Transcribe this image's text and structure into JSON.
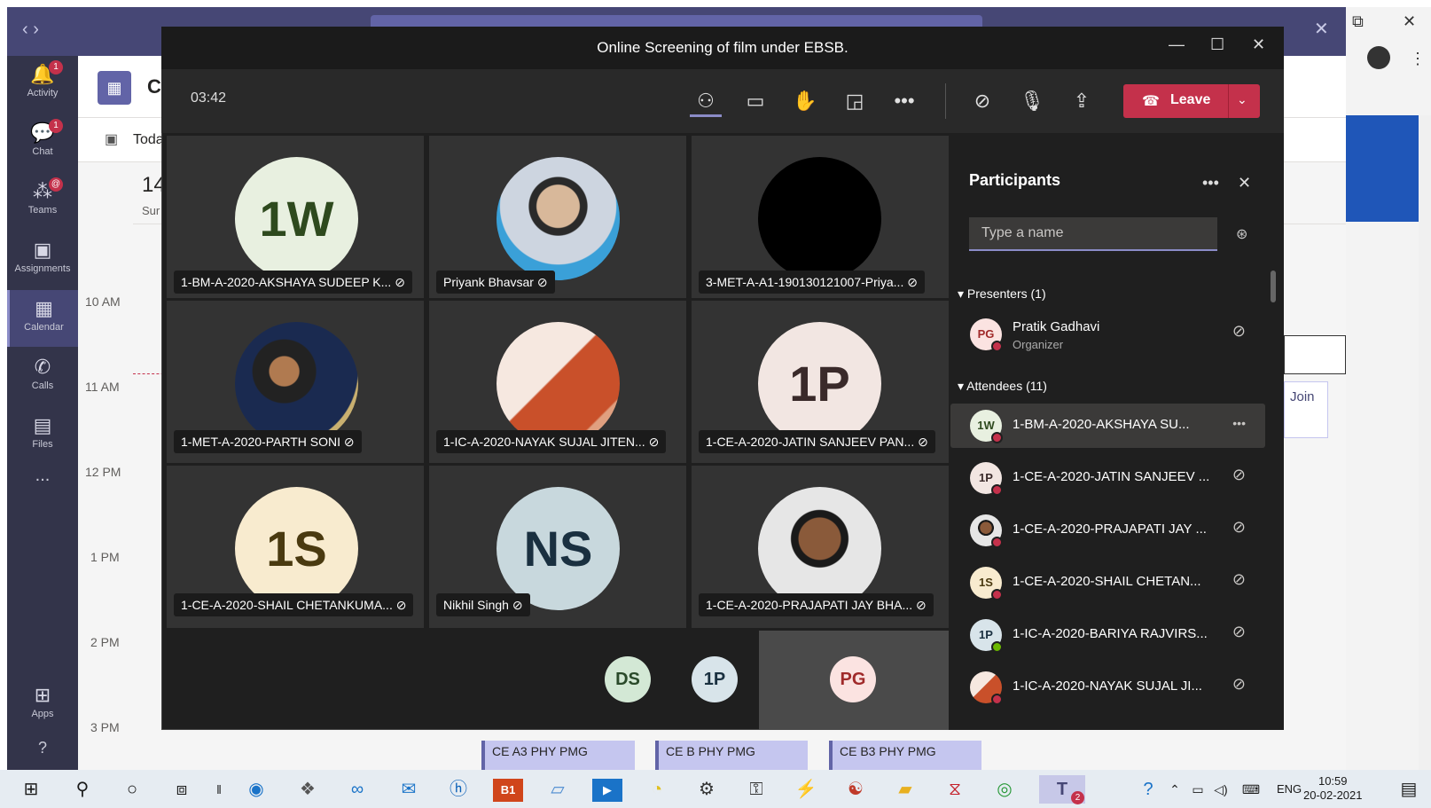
{
  "teams_rail": {
    "items": [
      {
        "label": "Activity",
        "icon": "bell-icon",
        "badge": "1"
      },
      {
        "label": "Chat",
        "icon": "chat-icon",
        "badge": "1"
      },
      {
        "label": "Teams",
        "icon": "teams-icon",
        "badge": "@"
      },
      {
        "label": "Assignments",
        "icon": "assignments-icon",
        "badge": ""
      },
      {
        "label": "Calendar",
        "icon": "calendar-icon",
        "badge": ""
      },
      {
        "label": "Calls",
        "icon": "phone-icon",
        "badge": ""
      },
      {
        "label": "Files",
        "icon": "file-icon",
        "badge": ""
      },
      {
        "label": "...",
        "icon": "more-icon",
        "badge": ""
      }
    ],
    "apps_label": "Apps",
    "help": "?"
  },
  "calendar": {
    "title": "Ca",
    "today_label": "Toda",
    "day_number": "14",
    "day_name": "Sur",
    "times": [
      "10 AM",
      "11 AM",
      "12 PM",
      "1 PM",
      "2 PM",
      "3 PM"
    ],
    "events": [
      "CE A3 PHY PMG",
      "CE B PHY PMG",
      "CE B3 PHY PMG"
    ],
    "join_label": "Join"
  },
  "meeting": {
    "title": "Online Screening of film under EBSB.",
    "timer": "03:42",
    "leave_label": "Leave",
    "tiles": [
      {
        "initials": "1W",
        "name": "1-BM-A-2020-AKSHAYA SUDEEP K..."
      },
      {
        "initials": "",
        "name": "Priyank Bhavsar"
      },
      {
        "initials": "",
        "name": "3-MET-A-A1-190130121007-Priya..."
      },
      {
        "initials": "",
        "name": "1-MET-A-2020-PARTH SONI"
      },
      {
        "initials": "",
        "name": "1-IC-A-2020-NAYAK SUJAL JITEN..."
      },
      {
        "initials": "1P",
        "name": "1-CE-A-2020-JATIN SANJEEV PAN..."
      },
      {
        "initials": "1S",
        "name": "1-CE-A-2020-SHAIL CHETANKUMA..."
      },
      {
        "initials": "NS",
        "name": "Nikhil Singh"
      },
      {
        "initials": "",
        "name": "1-CE-A-2020-PRAJAPATI JAY BHA..."
      }
    ],
    "overflow": [
      "DS",
      "1P",
      "PG"
    ]
  },
  "participants": {
    "title": "Participants",
    "search_placeholder": "Type a name",
    "presenters_label": "Presenters (1)",
    "attendees_label": "Attendees (11)",
    "presenter": {
      "initials": "PG",
      "name": "Pratik Gadhavi",
      "role": "Organizer"
    },
    "attendees": [
      {
        "initials": "1W",
        "name": "1-BM-A-2020-AKSHAYA SU..."
      },
      {
        "initials": "1P",
        "name": "1-CE-A-2020-JATIN SANJEEV ..."
      },
      {
        "initials": "",
        "name": "1-CE-A-2020-PRAJAPATI JAY ..."
      },
      {
        "initials": "1S",
        "name": "1-CE-A-2020-SHAIL CHETAN..."
      },
      {
        "initials": "1P",
        "name": "1-IC-A-2020-BARIYA RAJVIRS..."
      },
      {
        "initials": "",
        "name": "1-IC-A-2020-NAYAK SUJAL JI..."
      }
    ]
  },
  "taskbar": {
    "lang": "ENG",
    "time": "10:59",
    "date": "20-02-2021",
    "teams_badge": "2"
  }
}
